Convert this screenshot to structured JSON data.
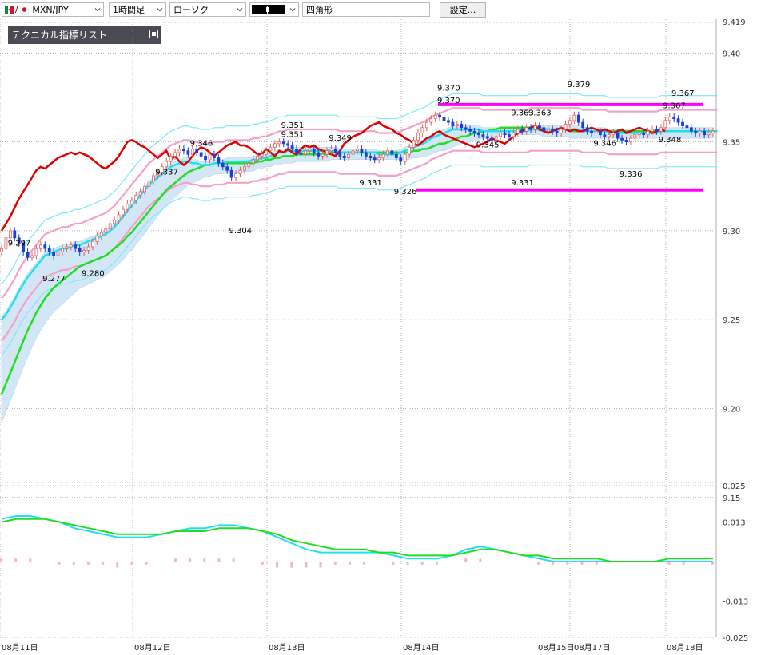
{
  "toolbar": {
    "pair_label": "MXN/JPY",
    "timeframe": "1時間足",
    "chart_style": "ローソク",
    "drawing_tool": "四角形",
    "settings_label": "設定..."
  },
  "indicator_panel": {
    "title": "テクニカル指標リスト"
  },
  "colors": {
    "price_line": "#e00000",
    "bull_candle": "#e06060",
    "bear_candle": "#1a3fd8",
    "fast_ma": "#22e0f0",
    "slow_ma": "#22dd22",
    "bollinger_inner": "#f4a0c8",
    "bollinger_outer": "#7ee8f8",
    "cloud": "#cfe4f6",
    "box_lines": "#ff00ff",
    "histogram": "#f7b4c8"
  },
  "chart_data": [
    {
      "type": "candlestick",
      "title": "",
      "price_axis": {
        "ticks": [
          "9.40",
          "9.35",
          "9.30",
          "9.25",
          "9.20",
          "9.15"
        ],
        "top_partial": "9.419",
        "ylim": [
          9.146,
          9.419
        ]
      },
      "time_axis": {
        "ticks": [
          "08月11日",
          "08月12日",
          "08月13日",
          "08月14日",
          "08月15日",
          "08月17日",
          "08月18日"
        ]
      },
      "horizontal_box": {
        "upper": 9.371,
        "lower": 9.323
      },
      "price_labels": [
        {
          "text": "9.297",
          "time_index": 4,
          "value": 9.297
        },
        {
          "text": "9.277",
          "time_index": 12,
          "value": 9.277
        },
        {
          "text": "9.280",
          "time_index": 21,
          "value": 9.28
        },
        {
          "text": "9.337",
          "time_index": 38,
          "value": 9.337
        },
        {
          "text": "9.346",
          "time_index": 46,
          "value": 9.346
        },
        {
          "text": "9.304",
          "time_index": 55,
          "value": 9.304
        },
        {
          "text": "9.351",
          "time_index": 67,
          "value": 9.351
        },
        {
          "text": "9.351",
          "time_index": 67,
          "value": 9.356
        },
        {
          "text": "9.349",
          "time_index": 78,
          "value": 9.349
        },
        {
          "text": "9.331",
          "time_index": 85,
          "value": 9.331
        },
        {
          "text": "9.326",
          "time_index": 93,
          "value": 9.326
        },
        {
          "text": "9.370",
          "time_index": 103,
          "value": 9.37
        },
        {
          "text": "9.370",
          "time_index": 103,
          "value": 9.377
        },
        {
          "text": "9.345",
          "time_index": 112,
          "value": 9.345
        },
        {
          "text": "9.331",
          "time_index": 120,
          "value": 9.331
        },
        {
          "text": "9.363",
          "time_index": 120,
          "value": 9.363
        },
        {
          "text": "9.363",
          "time_index": 124,
          "value": 9.363
        },
        {
          "text": "9.379",
          "time_index": 133,
          "value": 9.379
        },
        {
          "text": "9.346",
          "time_index": 139,
          "value": 9.346
        },
        {
          "text": "9.336",
          "time_index": 145,
          "value": 9.336
        },
        {
          "text": "9.367",
          "time_index": 155,
          "value": 9.367
        },
        {
          "text": "9.367",
          "time_index": 157,
          "value": 9.374
        },
        {
          "text": "9.348",
          "time_index": 154,
          "value": 9.348
        }
      ],
      "close": [
        9.29,
        9.296,
        9.3,
        9.296,
        9.293,
        9.288,
        9.285,
        9.286,
        9.29,
        9.292,
        9.29,
        9.288,
        9.286,
        9.288,
        9.29,
        9.291,
        9.292,
        9.29,
        9.288,
        9.289,
        9.291,
        9.294,
        9.297,
        9.299,
        9.301,
        9.304,
        9.306,
        9.309,
        9.312,
        9.315,
        9.317,
        9.32,
        9.322,
        9.325,
        9.328,
        9.331,
        9.333,
        9.336,
        9.339,
        9.342,
        9.344,
        9.346,
        9.345,
        9.343,
        9.346,
        9.344,
        9.342,
        9.34,
        9.343,
        9.341,
        9.338,
        9.336,
        9.334,
        9.33,
        9.332,
        9.334,
        9.336,
        9.338,
        9.34,
        9.342,
        9.343,
        9.345,
        9.347,
        9.349,
        9.35,
        9.349,
        9.348,
        9.346,
        9.344,
        9.343,
        9.345,
        9.346,
        9.344,
        9.342,
        9.343,
        9.345,
        9.346,
        9.344,
        9.342,
        9.341,
        9.343,
        9.345,
        9.346,
        9.344,
        9.342,
        9.341,
        9.34,
        9.341,
        9.343,
        9.345,
        9.343,
        9.341,
        9.339,
        9.343,
        9.347,
        9.351,
        9.355,
        9.358,
        9.361,
        9.363,
        9.365,
        9.364,
        9.362,
        9.361,
        9.359,
        9.36,
        9.358,
        9.357,
        9.356,
        9.355,
        9.354,
        9.353,
        9.352,
        9.351,
        9.353,
        9.355,
        9.354,
        9.353,
        9.355,
        9.357,
        9.356,
        9.358,
        9.357,
        9.359,
        9.358,
        9.356,
        9.357,
        9.356,
        9.355,
        9.357,
        9.36,
        9.362,
        9.365,
        9.361,
        9.358,
        9.356,
        9.355,
        9.356,
        9.354,
        9.353,
        9.354,
        9.355,
        9.352,
        9.351,
        9.35,
        9.352,
        9.354,
        9.355,
        9.354,
        9.356,
        9.357,
        9.356,
        9.358,
        9.362,
        9.364,
        9.363,
        9.361,
        9.359,
        9.358,
        9.356,
        9.355,
        9.356,
        9.354,
        9.355,
        9.356
      ],
      "price_line": [
        9.3,
        9.304,
        9.308,
        9.313,
        9.318,
        9.322,
        9.326,
        9.33,
        9.334,
        9.336,
        9.335,
        9.337,
        9.339,
        9.341,
        9.342,
        9.343,
        9.344,
        9.343,
        9.344,
        9.343,
        9.342,
        9.34,
        9.338,
        9.336,
        9.335,
        9.337,
        9.339,
        9.342,
        9.346,
        9.35,
        9.351,
        9.35,
        9.348,
        9.347,
        9.345,
        9.343,
        9.341,
        9.343,
        9.345,
        9.34,
        9.342,
        9.339,
        9.337,
        9.339,
        9.342,
        9.345,
        9.347,
        9.346,
        9.344,
        9.342,
        9.344,
        9.346,
        9.348,
        9.349,
        9.35,
        9.348,
        9.348,
        9.347,
        9.345,
        9.343,
        9.343,
        9.346,
        9.344,
        9.342,
        9.345,
        9.344,
        9.346,
        9.344,
        9.343,
        9.346,
        9.348,
        9.347,
        9.348,
        9.346,
        9.345,
        9.344,
        9.343,
        9.342,
        9.345,
        9.349,
        9.351,
        9.353,
        9.354,
        9.355,
        9.357,
        9.359,
        9.36,
        9.361,
        9.359,
        9.358,
        9.357,
        9.355,
        9.354,
        9.352,
        9.351,
        9.349,
        9.348,
        9.35,
        9.352,
        9.353,
        9.355,
        9.356,
        9.354,
        9.353,
        9.352,
        9.351,
        9.35,
        9.349,
        9.348,
        9.347,
        9.348,
        9.349,
        9.35,
        9.352,
        9.351,
        9.35,
        9.349,
        9.351,
        9.353,
        9.355,
        9.356,
        9.357,
        9.358,
        9.359,
        9.357,
        9.356,
        9.355,
        9.356,
        9.357,
        9.358,
        9.357,
        9.356,
        9.357,
        9.356,
        9.356,
        9.357,
        9.358,
        9.357,
        9.356,
        9.357,
        9.356,
        9.355,
        9.356,
        9.357,
        9.355,
        9.356,
        9.357,
        9.358,
        9.357,
        9.356,
        9.355,
        9.356,
        9.357,
        9.356
      ],
      "fast_ma": [
        9.25,
        9.253,
        9.257,
        9.261,
        9.266,
        9.27,
        9.274,
        9.277,
        9.28,
        9.283,
        9.286,
        9.287,
        9.288,
        9.289,
        9.29,
        9.29,
        9.291,
        9.292,
        9.292,
        9.293,
        9.294,
        9.295,
        9.296,
        9.297,
        9.298,
        9.3,
        9.302,
        9.305,
        9.308,
        9.311,
        9.314,
        9.317,
        9.32,
        9.323,
        9.326,
        9.328,
        9.33,
        9.332,
        9.334,
        9.336,
        9.337,
        9.338,
        9.339,
        9.339,
        9.338,
        9.338,
        9.337,
        9.337,
        9.337,
        9.338,
        9.338,
        9.338,
        9.339,
        9.339,
        9.339,
        9.339,
        9.339,
        9.339,
        9.34,
        9.34,
        9.341,
        9.341,
        9.342,
        9.343,
        9.344,
        9.344,
        9.345,
        9.345,
        9.345,
        9.345,
        9.345,
        9.345,
        9.345,
        9.345,
        9.345,
        9.345,
        9.345,
        9.345,
        9.344,
        9.344,
        9.344,
        9.344,
        9.344,
        9.344,
        9.344,
        9.344,
        9.344,
        9.343,
        9.343,
        9.343,
        9.343,
        9.343,
        9.344,
        9.345,
        9.346,
        9.347,
        9.348,
        9.349,
        9.35,
        9.352,
        9.353,
        9.354,
        9.355,
        9.356,
        9.357,
        9.357,
        9.357,
        9.357,
        9.357,
        9.357,
        9.357,
        9.356,
        9.356,
        9.356,
        9.356,
        9.356,
        9.356,
        9.356,
        9.356,
        9.356,
        9.356,
        9.356,
        9.357,
        9.357,
        9.357,
        9.357,
        9.357,
        9.357,
        9.357,
        9.357,
        9.357,
        9.357,
        9.357,
        9.357,
        9.356,
        9.356,
        9.356,
        9.356,
        9.356,
        9.356,
        9.355,
        9.355,
        9.355,
        9.355,
        9.355,
        9.355,
        9.355,
        9.355,
        9.355,
        9.355,
        9.355,
        9.355,
        9.356,
        9.356,
        9.356,
        9.356,
        9.356,
        9.356,
        9.356,
        9.356,
        9.356,
        9.356,
        9.356,
        9.356,
        9.356,
        9.356
      ],
      "slow_ma": [
        9.208,
        9.214,
        9.22,
        9.226,
        9.232,
        9.238,
        9.244,
        9.249,
        9.254,
        9.258,
        9.262,
        9.265,
        9.268,
        9.27,
        9.272,
        9.274,
        9.276,
        9.278,
        9.28,
        9.281,
        9.282,
        9.283,
        9.284,
        9.285,
        9.286,
        9.288,
        9.29,
        9.292,
        9.294,
        9.297,
        9.299,
        9.302,
        9.305,
        9.308,
        9.311,
        9.314,
        9.317,
        9.32,
        9.323,
        9.325,
        9.327,
        9.329,
        9.331,
        9.333,
        9.334,
        9.335,
        9.336,
        9.337,
        9.337,
        9.338,
        9.338,
        9.338,
        9.338,
        9.338,
        9.338,
        9.338,
        9.338,
        9.338,
        9.338,
        9.339,
        9.339,
        9.34,
        9.34,
        9.341,
        9.341,
        9.342,
        9.342,
        9.342,
        9.343,
        9.343,
        9.343,
        9.343,
        9.343,
        9.343,
        9.343,
        9.343,
        9.344,
        9.344,
        9.344,
        9.344,
        9.344,
        9.344,
        9.344,
        9.344,
        9.344,
        9.344,
        9.344,
        9.344,
        9.344,
        9.344,
        9.344,
        9.344,
        9.344,
        9.344,
        9.344,
        9.345,
        9.345,
        9.346,
        9.346,
        9.347,
        9.348,
        9.349,
        9.349,
        9.35,
        9.351,
        9.352,
        9.353,
        9.353,
        9.354,
        9.355,
        9.355,
        9.356,
        9.356,
        9.357,
        9.357,
        9.358,
        9.358,
        9.358,
        9.358,
        9.358,
        9.358,
        9.358,
        9.358,
        9.358,
        9.358,
        9.357,
        9.357,
        9.357,
        9.357,
        9.357,
        9.357,
        9.356,
        9.356,
        9.356,
        9.356,
        9.356,
        9.356,
        9.356,
        9.356,
        9.356,
        9.356,
        9.356,
        9.356,
        9.356,
        9.356,
        9.356,
        9.356,
        9.356,
        9.356,
        9.356,
        9.356,
        9.356,
        9.356,
        9.356,
        9.356,
        9.356,
        9.356,
        9.356,
        9.356,
        9.356,
        9.356,
        9.356,
        9.356,
        9.356,
        9.356,
        9.356
      ]
    },
    {
      "type": "line",
      "title": "",
      "y_axis": {
        "ticks": [
          "0.025",
          "0.013",
          "-0.013",
          "-0.025"
        ],
        "ylim": [
          -0.025,
          0.025
        ]
      },
      "series": [
        {
          "name": "",
          "color": "#22e0f0",
          "values": [
            0.014,
            0.015,
            0.015,
            0.014,
            0.013,
            0.011,
            0.01,
            0.009,
            0.008,
            0.008,
            0.008,
            0.009,
            0.01,
            0.011,
            0.011,
            0.012,
            0.012,
            0.011,
            0.01,
            0.008,
            0.006,
            0.004,
            0.003,
            0.003,
            0.003,
            0.003,
            0.003,
            0.002,
            0.001,
            0.001,
            0.001,
            0.002,
            0.004,
            0.005,
            0.004,
            0.003,
            0.002,
            0.001,
            0.0,
            0.0,
            0.0,
            0.0,
            0.0,
            0.0,
            0.0,
            0.0,
            0.0,
            0.0,
            0.0,
            0.0
          ]
        },
        {
          "name": "",
          "color": "#22dd22",
          "values": [
            0.013,
            0.014,
            0.014,
            0.014,
            0.013,
            0.012,
            0.011,
            0.01,
            0.009,
            0.009,
            0.009,
            0.009,
            0.01,
            0.01,
            0.01,
            0.011,
            0.011,
            0.011,
            0.01,
            0.009,
            0.007,
            0.006,
            0.005,
            0.004,
            0.004,
            0.004,
            0.003,
            0.003,
            0.002,
            0.002,
            0.002,
            0.002,
            0.003,
            0.004,
            0.004,
            0.003,
            0.002,
            0.002,
            0.001,
            0.001,
            0.001,
            0.001,
            0.0,
            0.0,
            0.0,
            0.0,
            0.001,
            0.001,
            0.001,
            0.001
          ]
        },
        {
          "name": "",
          "color": "#f7b4c8",
          "type": "histogram",
          "values": [
            0.001,
            0.001,
            0.001,
            0.0,
            -0.001,
            -0.001,
            -0.001,
            -0.001,
            -0.002,
            -0.001,
            -0.001,
            0.0,
            0.001,
            0.001,
            0.001,
            0.001,
            0.001,
            0.0,
            -0.001,
            -0.002,
            -0.002,
            -0.002,
            -0.002,
            -0.001,
            -0.001,
            -0.001,
            0.0,
            -0.001,
            -0.001,
            -0.001,
            -0.001,
            0.0,
            0.001,
            0.001,
            0.0,
            0.0,
            0.0,
            -0.001,
            -0.001,
            -0.001,
            -0.001,
            -0.001,
            0.0,
            0.0,
            0.0,
            0.0,
            -0.001,
            -0.001,
            0.0,
            -0.001
          ]
        }
      ]
    }
  ]
}
